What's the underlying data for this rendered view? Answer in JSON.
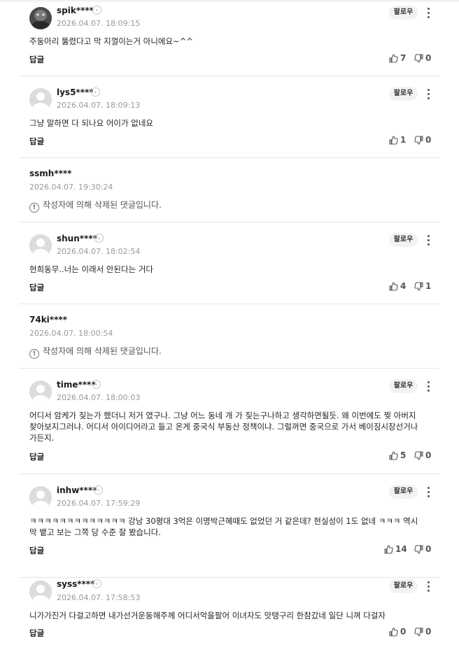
{
  "labels": {
    "follow": "팔로우",
    "reply": "답글"
  },
  "comments": [
    {
      "nick": "spik****",
      "date": "2026.04.07. 18:09:15",
      "text": "주둥아리 뚫렸다고 막 지껄이는거 아니에요~^^",
      "likes": "7",
      "dislikes": "0",
      "avatar": "photo"
    },
    {
      "nick": "lys5****",
      "date": "2026.04.07. 18:09:13",
      "text": "그냥 말하면 다 되나요 어이가 없네요",
      "likes": "1",
      "dislikes": "0"
    },
    {
      "nick": "ssmh****",
      "date": "2026.04.07. 19:30:24",
      "deleted": "작성자에 의해 삭제된 댓글입니다."
    },
    {
      "nick": "shun****",
      "date": "2026.04.07. 18:02:54",
      "text": "현희동무..너는 이래서 안된다는 거다",
      "likes": "4",
      "dislikes": "1"
    },
    {
      "nick": "74ki****",
      "date": "2026.04.07. 18:00:54",
      "deleted": "작성자에 의해 삭제된 댓글입니다."
    },
    {
      "nick": "time****",
      "date": "2026.04.07. 18:00:03",
      "text": "어디서 암케가 짖는가 했더니 저거 였구나. 그냥 어느 동네 개 가 짖는구나하고 생각하면될듯. 왜 이번에도 찢 아버지 찾아보지그러냐. 어디서 아이디어라고 들고 온게 중국식 부동산 정책이냐. 그럴꺼면 중국으로 가서 베이징시장선거나가든지.",
      "likes": "5",
      "dislikes": "0"
    },
    {
      "nick": "inhw****",
      "date": "2026.04.07. 17:59:29",
      "text": "ㅋㅋㅋㅋㅋㅋㅋㅋㅋㅋㅋㅋㅋ 강남 30평대 3억은 이명박근혜때도 없었던 거 같은데? 현실성이 1도 없네 ㅋㅋㅋ 역시 막 뱉고 보는 그쪽 당 수준 잘 봤습니다.",
      "likes": "14",
      "dislikes": "0"
    },
    {
      "nick": "syss****",
      "date": "2026.04.07. 17:58:53",
      "text": "니가가진거 다걸고하면 내가선거운동해주께 어디서악을팔어 이녀자도 맛탱구리 한참갔네 일단 니껴 다걸자",
      "likes": "0",
      "dislikes": "0"
    }
  ]
}
